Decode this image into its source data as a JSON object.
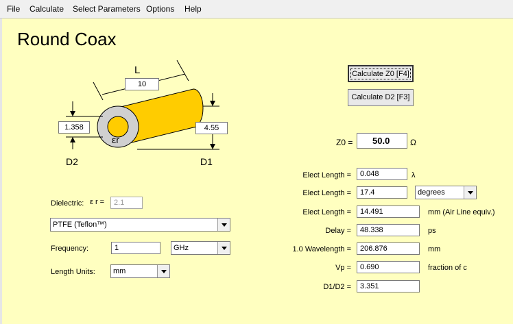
{
  "menu": [
    "File",
    "Calculate",
    "Select Parameters",
    "Options",
    "Help"
  ],
  "title": "Round Coax",
  "diagram": {
    "length_label": "L",
    "length_value": "10",
    "d2_value": "1.358",
    "d1_value": "4.55",
    "d2_label": "D2",
    "d1_label": "D1",
    "er_symbol": "εr",
    "outer_color": "#ffcc00",
    "inner_color": "#d0d0d0"
  },
  "buttons": {
    "calc_z0": "Calculate Z0  [F4]",
    "calc_d2": "Calculate D2  [F3]"
  },
  "z0": {
    "label": "Z0 =",
    "value": "50.0",
    "unit": "Ω"
  },
  "dielectric": {
    "label": "Dielectric:",
    "er_label": "ε r =",
    "er_value": "2.1",
    "material": "PTFE  (Teflon™)"
  },
  "frequency": {
    "label": "Frequency:",
    "value": "1",
    "unit": "GHz"
  },
  "length_units": {
    "label": "Length Units:",
    "value": "mm"
  },
  "results": [
    {
      "label": "Elect Length =",
      "value": "0.048",
      "unit": "λ"
    },
    {
      "label": "Elect Length =",
      "value": "17.4",
      "unit": "degrees"
    },
    {
      "label": "Elect Length =",
      "value": "14.491",
      "unit": "mm  (Air Line equiv.)"
    },
    {
      "label": "Delay =",
      "value": "48.338",
      "unit": "ps"
    },
    {
      "label": "1.0 Wavelength =",
      "value": "206.876",
      "unit": "mm"
    },
    {
      "label": "Vp =",
      "value": "0.690",
      "unit": "fraction of c"
    },
    {
      "label": "D1/D2 =",
      "value": "3.351",
      "unit": ""
    }
  ]
}
